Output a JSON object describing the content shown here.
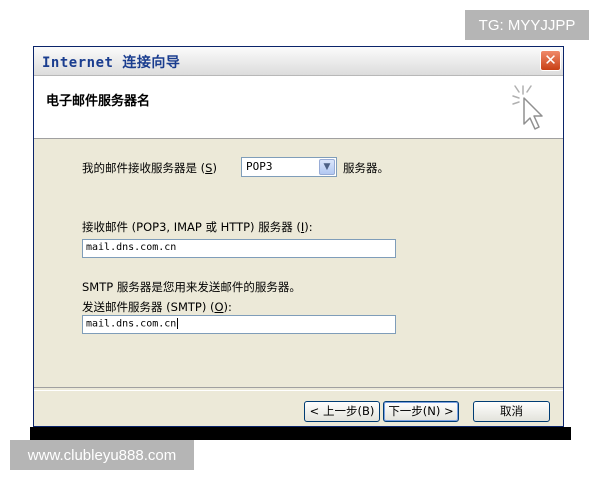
{
  "watermarks": {
    "top": "TG: MYYJJPP",
    "bottom": "www.clubleyu888.com"
  },
  "window": {
    "title": "Internet 连接向导",
    "close_glyph": "✕",
    "close_icon": "close-icon"
  },
  "header": {
    "title": "电子邮件服务器名",
    "icon": "wizard-cursor-icon"
  },
  "form": {
    "incoming_type_label_prefix": "我的邮件接收服务器是 (",
    "incoming_type_label_key": "S",
    "incoming_type_label_suffix": ")",
    "incoming_type_value": "POP3",
    "incoming_type_after": "服务器。",
    "incoming_server_label_prefix": "接收邮件 (POP3, IMAP 或 HTTP) 服务器 (",
    "incoming_server_label_key": "I",
    "incoming_server_label_suffix": "):",
    "incoming_server_value": "mail.dns.com.cn",
    "smtp_note": "SMTP 服务器是您用来发送邮件的服务器。",
    "outgoing_server_label_prefix": "发送邮件服务器 (SMTP) (",
    "outgoing_server_label_key": "O",
    "outgoing_server_label_suffix": "):",
    "outgoing_server_value": "mail.dns.com.cn"
  },
  "buttons": {
    "back": "< 上一步(B)",
    "next": "下一步(N) >",
    "cancel": "取消"
  },
  "colors": {
    "dialog_bg": "#ece9d8",
    "title_text": "#1a3d8f",
    "close_button": "#c84016",
    "input_border": "#7f9db9"
  }
}
